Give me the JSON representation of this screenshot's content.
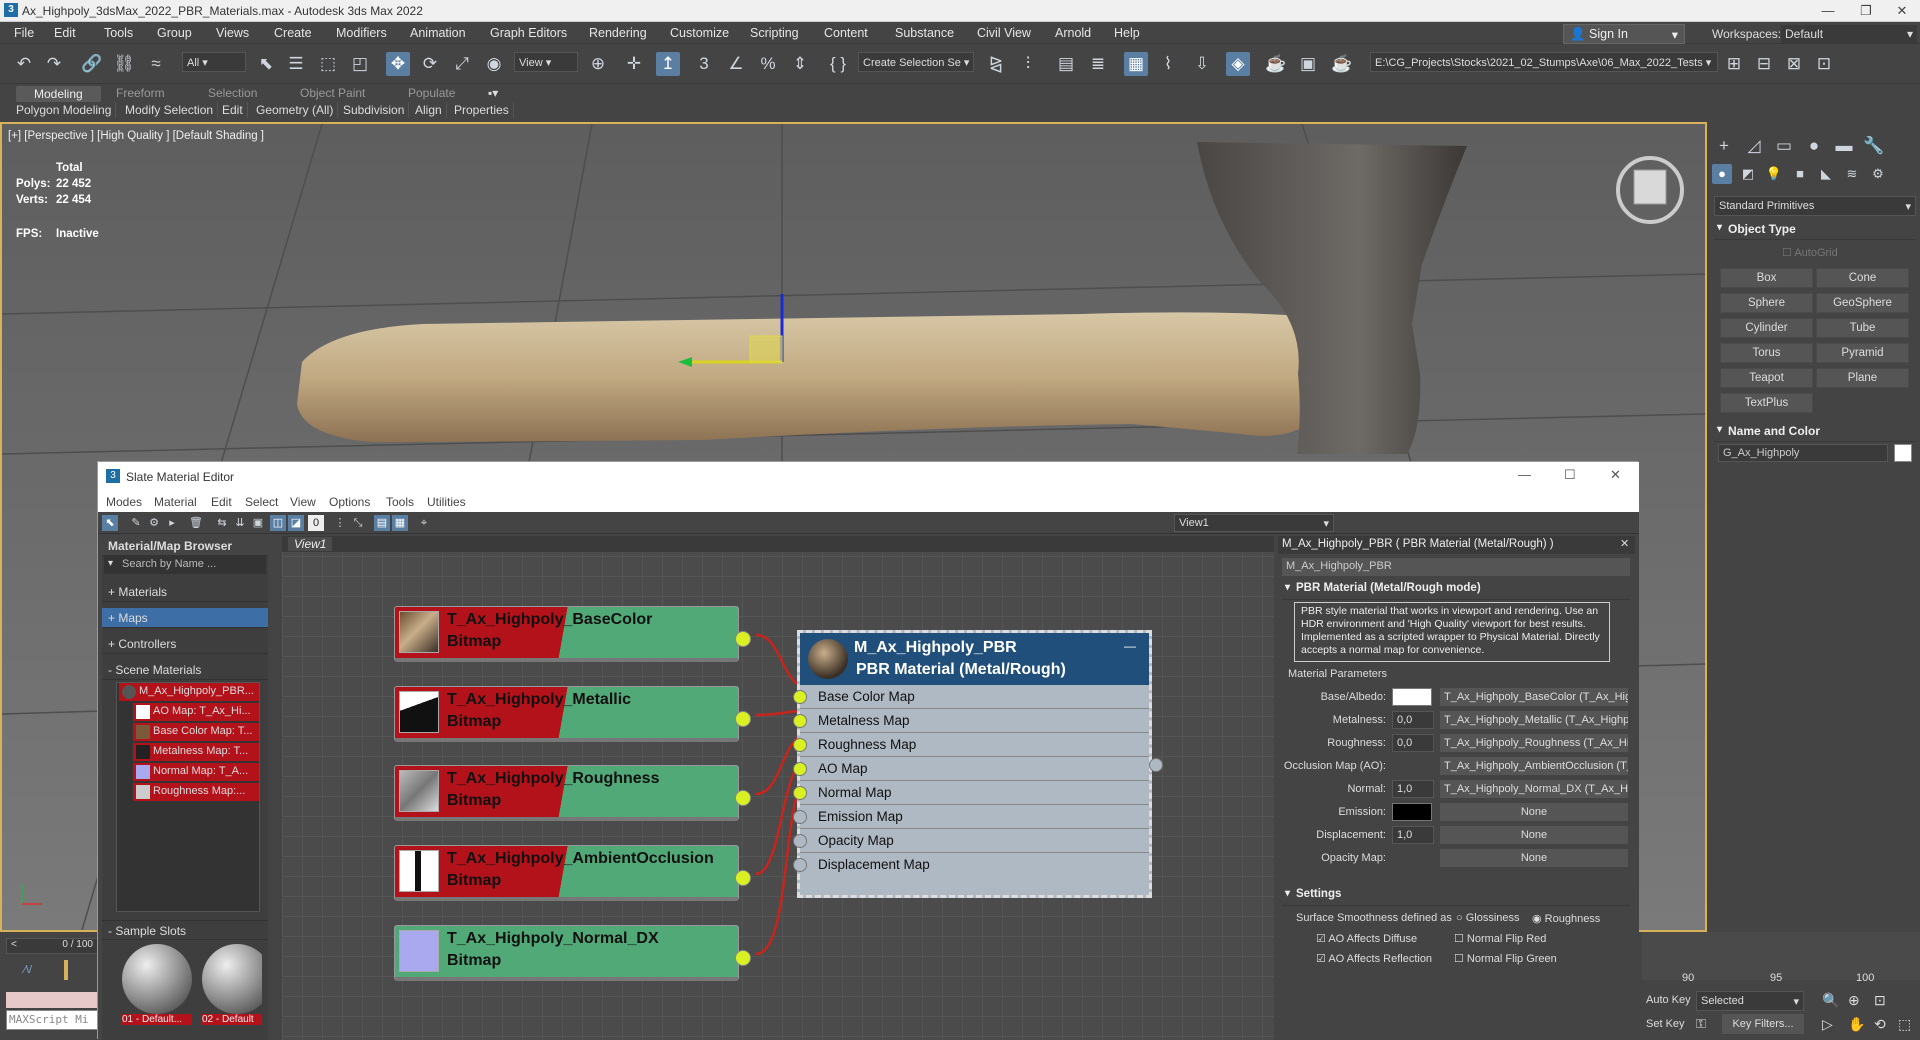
{
  "window": {
    "title": "Ax_Highpoly_3dsMax_2022_PBR_Materials.max - Autodesk 3ds Max 2022",
    "min": "—",
    "max": "❐",
    "close": "✕"
  },
  "menubar": [
    "File",
    "Edit",
    "Tools",
    "Group",
    "Views",
    "Create",
    "Modifiers",
    "Animation",
    "Graph Editors",
    "Rendering",
    "Customize",
    "Scripting",
    "Content",
    "Substance",
    "Civil View",
    "Arnold",
    "Help"
  ],
  "signin": "Sign In",
  "workspace": {
    "label": "Workspaces:",
    "value": "Default"
  },
  "toolbar": {
    "filter": "All",
    "refcoord": "View",
    "selset": "Create Selection Se",
    "path": "E:\\CG_Projects\\Stocks\\2021_02_Stumps\\Axe\\06_Max_2022_Tests"
  },
  "ribbon": {
    "tabs": [
      "Modeling",
      "Freeform",
      "Selection",
      "Object Paint",
      "Populate"
    ],
    "sub": [
      "Polygon Modeling",
      "Modify Selection",
      "Edit",
      "Geometry (All)",
      "Subdivision",
      "Align",
      "Properties"
    ]
  },
  "viewport": {
    "label": "[+] [Perspective ] [High Quality ] [Default Shading ]",
    "total": "Total",
    "polys_lbl": "Polys:",
    "polys": "22 452",
    "verts_lbl": "Verts:",
    "verts": "22 454",
    "fps_lbl": "FPS:",
    "fps": "Inactive"
  },
  "cmd": {
    "category": "Standard Primitives",
    "object_type": "Object Type",
    "autogrid": "AutoGrid",
    "buttons": [
      "Box",
      "Cone",
      "Sphere",
      "GeoSphere",
      "Cylinder",
      "Tube",
      "Torus",
      "Pyramid",
      "Teapot",
      "Plane",
      "TextPlus"
    ],
    "name_color": "Name and Color",
    "object_name": "G_Ax_Highpoly"
  },
  "timeline": {
    "frame": "0 / 100",
    "ticks": [
      "90",
      "95",
      "100"
    ]
  },
  "anim": {
    "autokey": "Auto Key",
    "selected": "Selected",
    "setkey": "Set Key",
    "keyfilters": "Key Filters..."
  },
  "maxscript": "MAXScript Mi",
  "slate": {
    "title": "Slate Material Editor",
    "menu": [
      "Modes",
      "Material",
      "Edit",
      "Select",
      "View",
      "Options",
      "Tools",
      "Utilities"
    ],
    "view_dropdown": "View1",
    "browser": {
      "title": "Material/Map Browser",
      "search": "Search by Name ...",
      "groups": [
        "+ Materials",
        "+ Maps",
        "+ Controllers",
        "- Scene Materials"
      ],
      "scene_items": [
        "M_Ax_Highpoly_PBR...",
        "AO Map: T_Ax_Hi...",
        "Base Color Map: T...",
        "Metalness Map: T...",
        "Normal Map: T_A...",
        "Roughness Map:..."
      ],
      "sample_slots": "- Sample Slots",
      "slot1": "01 - Default...",
      "slot2": "02 - Default"
    },
    "tab": "View1",
    "nodes": [
      {
        "name": "T_Ax_Highpoly_BaseColor",
        "type": "Bitmap"
      },
      {
        "name": "T_Ax_Highpoly_Metallic",
        "type": "Bitmap"
      },
      {
        "name": "T_Ax_Highpoly_Roughness",
        "type": "Bitmap"
      },
      {
        "name": "T_Ax_Highpoly_AmbientOcclusion",
        "type": "Bitmap"
      },
      {
        "name": "T_Ax_Highpoly_Normal_DX",
        "type": "Bitmap"
      }
    ],
    "pbr": {
      "name": "M_Ax_Highpoly_PBR",
      "type": "PBR Material (Metal/Rough)",
      "slots": [
        "Base Color Map",
        "Metalness Map",
        "Roughness Map",
        "AO Map",
        "Normal Map",
        "Emission Map",
        "Opacity Map",
        "Displacement Map"
      ]
    },
    "props": {
      "header": "M_Ax_Highpoly_PBR  ( PBR Material (Metal/Rough) )",
      "name": "M_Ax_Highpoly_PBR",
      "rollout": "PBR Material (Metal/Rough mode)",
      "desc": "PBR style material that works in viewport and rendering. Use an HDR environment and 'High Quality' viewport for best results. Implemented as a scripted wrapper to Physical Material. Directly accepts a normal map for convenience.",
      "params_title": "Material Parameters",
      "rows": [
        {
          "label": "Base/Albedo:",
          "value": "",
          "map": "T_Ax_Highpoly_BaseColor (T_Ax_Highp"
        },
        {
          "label": "Metalness:",
          "value": "0,0",
          "map": "T_Ax_Highpoly_Metallic (T_Ax_Highpol"
        },
        {
          "label": "Roughness:",
          "value": "0,0",
          "map": "T_Ax_Highpoly_Roughness (T_Ax_High"
        },
        {
          "label": "Occlusion Map (AO):",
          "value": "",
          "map": "T_Ax_Highpoly_AmbientOcclusion (T_A"
        },
        {
          "label": "Normal:",
          "value": "1,0",
          "map": "T_Ax_Highpoly_Normal_DX (T_Ax_High"
        },
        {
          "label": "Emission:",
          "value": "",
          "map": "None"
        },
        {
          "label": "Displacement:",
          "value": "1,0",
          "map": "None"
        },
        {
          "label": "Opacity Map:",
          "value": "",
          "map": "None"
        }
      ],
      "settings": "Settings",
      "smooth_lbl": "Surface Smoothness defined as",
      "gloss": "Glossiness",
      "rough": "Roughness",
      "ao_diffuse": "AO Affects Diffuse",
      "ao_refl": "AO Affects Reflection",
      "flip_red": "Normal Flip Red",
      "flip_green": "Normal Flip Green"
    }
  }
}
